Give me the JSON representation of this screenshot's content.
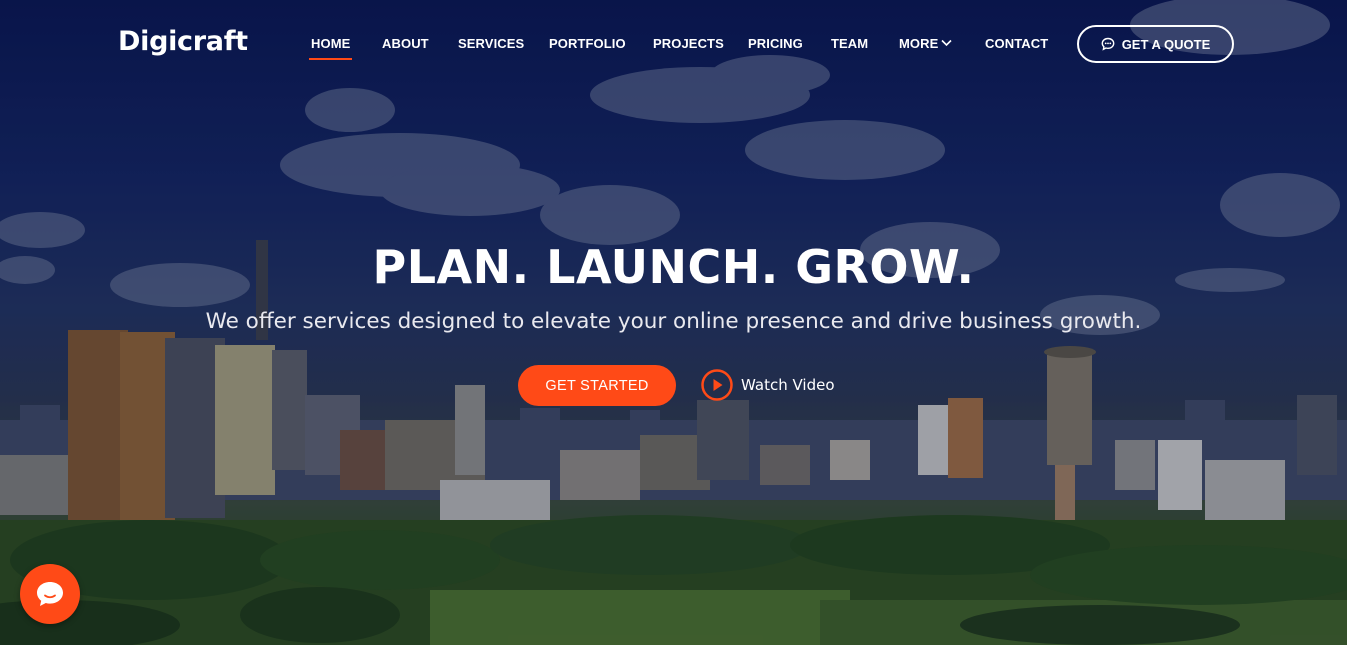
{
  "header": {
    "logo": "Digicraft",
    "nav": [
      {
        "label": "HOME",
        "active": true
      },
      {
        "label": "ABOUT"
      },
      {
        "label": "SERVICES"
      },
      {
        "label": "PORTFOLIO"
      },
      {
        "label": "PROJECTS"
      },
      {
        "label": "PRICING"
      },
      {
        "label": "TEAM"
      },
      {
        "label": "MORE",
        "dropdown": true
      },
      {
        "label": "CONTACT"
      }
    ],
    "quote_button": {
      "label": "GET A QUOTE",
      "icon": "chat-dots-icon"
    }
  },
  "hero": {
    "headline": "PLAN. LAUNCH. GROW.",
    "subline": "We offer services designed to elevate your online presence and drive business growth.",
    "cta_label": "GET STARTED",
    "watch_label": "Watch Video",
    "watch_icon": "play-circle-icon"
  },
  "chat_widget": {
    "icon": "chat-bubble-icon"
  },
  "colors": {
    "accent": "#ff4a17",
    "text": "#ffffff",
    "sky": "#0a1650"
  }
}
